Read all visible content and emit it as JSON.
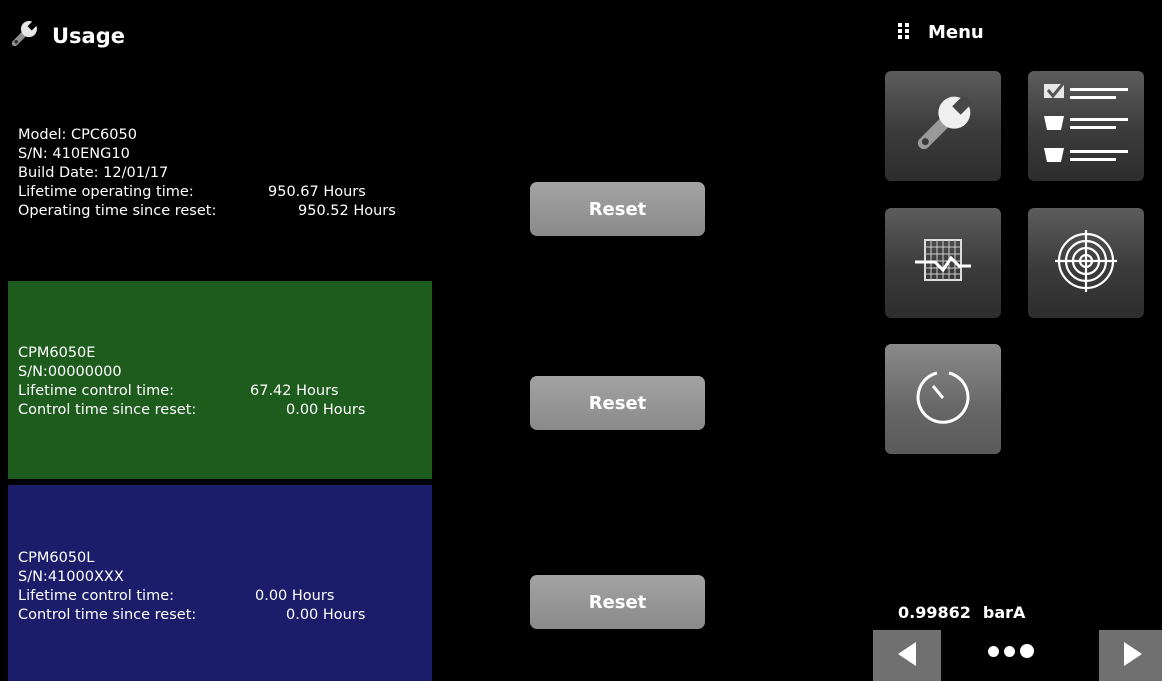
{
  "header": {
    "title": "Usage",
    "title_icon": "wrench-icon",
    "menu_label": "Menu",
    "menu_icon": "grid-dots-icon"
  },
  "panels": [
    {
      "name": "base-unit",
      "color": "#000000",
      "lines": [
        {
          "label": "Model: CPC6050",
          "value": ""
        },
        {
          "label": "S/N: 410ENG10",
          "value": ""
        },
        {
          "label": "Build Date: 12/01/17",
          "value": ""
        },
        {
          "label": "Lifetime operating time:",
          "value": "950.67 Hours"
        },
        {
          "label": "Operating time since reset:",
          "value": "950.52 Hours"
        }
      ],
      "reset_label": "Reset"
    },
    {
      "name": "control-module",
      "color": "#1e5c1e",
      "lines": [
        {
          "label": "CPM6050E",
          "value": ""
        },
        {
          "label": "S/N:00000000",
          "value": ""
        },
        {
          "label": "Lifetime control time:",
          "value": "67.42 Hours"
        },
        {
          "label": "Control time since reset:",
          "value": "0.00 Hours"
        }
      ],
      "reset_label": "Reset"
    },
    {
      "name": "leak-module",
      "color": "#1b1d6b",
      "lines": [
        {
          "label": "CPM6050L",
          "value": ""
        },
        {
          "label": "S/N:41000XXX",
          "value": ""
        },
        {
          "label": "Lifetime control time:",
          "value": "0.00 Hours"
        },
        {
          "label": "Control time since reset:",
          "value": "0.00 Hours"
        }
      ],
      "reset_label": "Reset"
    }
  ],
  "menu_tiles": [
    {
      "name": "tools",
      "icon": "wrench-icon"
    },
    {
      "name": "settings",
      "icon": "checklist-icon"
    },
    {
      "name": "chart",
      "icon": "chart-grid-icon"
    },
    {
      "name": "target",
      "icon": "target-icon"
    },
    {
      "name": "timer",
      "icon": "timer-icon"
    }
  ],
  "reading": {
    "value": "0.99862",
    "unit": "barA"
  },
  "nav": {
    "prev_icon": "arrow-left-icon",
    "next_icon": "arrow-right-icon",
    "page_indicator_icon": "page-dots-icon"
  }
}
